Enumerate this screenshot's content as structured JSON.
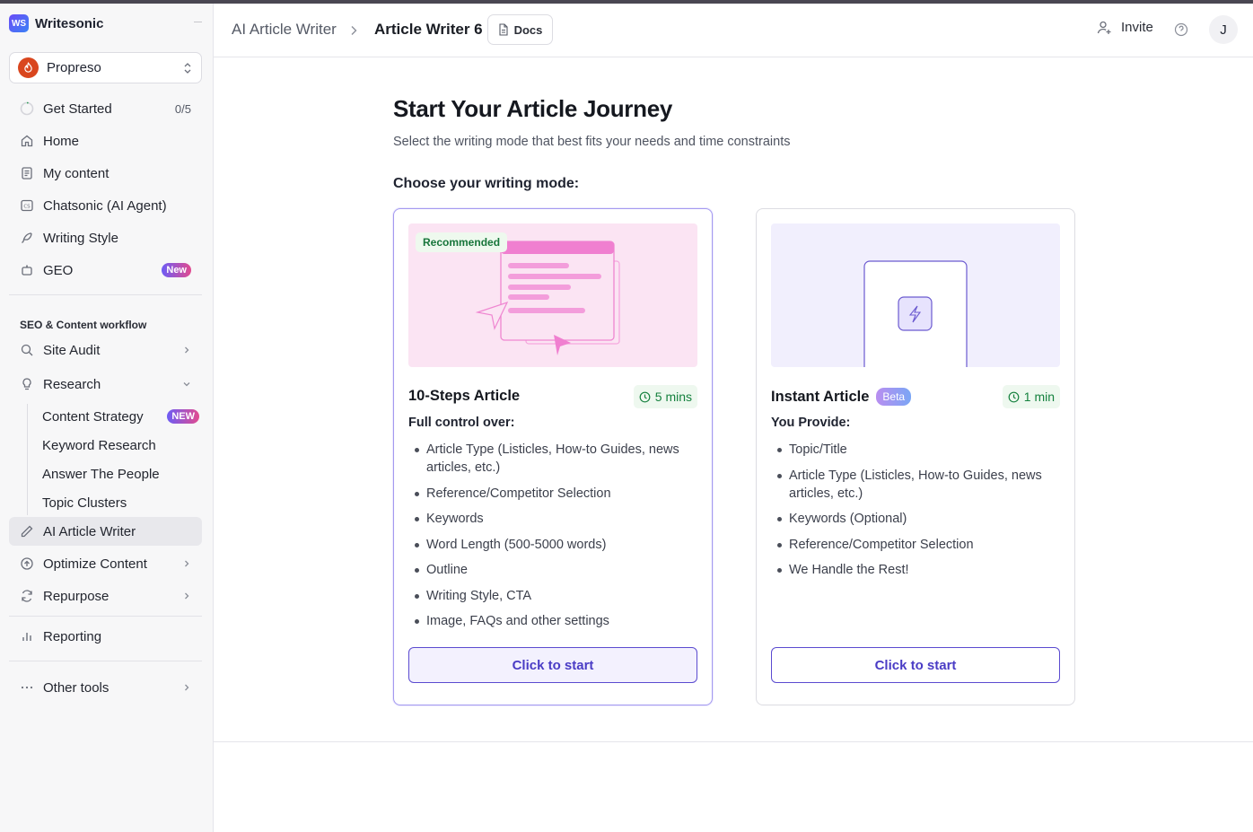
{
  "brand": {
    "logo_text": "WS",
    "name": "Writesonic"
  },
  "workspace": {
    "name": "Propreso"
  },
  "sidebar": {
    "top_items": [
      {
        "label": "Get Started",
        "right": "0/5"
      },
      {
        "label": "Home"
      },
      {
        "label": "My content"
      },
      {
        "label": "Chatsonic (AI Agent)"
      },
      {
        "label": "Writing Style"
      },
      {
        "label": "GEO",
        "badge": "New"
      }
    ],
    "section_label": "SEO & Content workflow",
    "workflow": {
      "site_audit": "Site Audit",
      "research": "Research",
      "research_sub": [
        {
          "label": "Content Strategy",
          "badge": "NEW"
        },
        {
          "label": "Keyword Research"
        },
        {
          "label": "Answer The People"
        },
        {
          "label": "Topic Clusters"
        }
      ],
      "ai_article_writer": "AI Article Writer",
      "optimize_content": "Optimize Content",
      "repurpose": "Repurpose"
    },
    "reporting": "Reporting",
    "other_tools": "Other tools"
  },
  "header": {
    "breadcrumb_parent": "AI Article Writer",
    "breadcrumb_current": "Article Writer 6",
    "docs_label": "Docs",
    "invite_label": "Invite",
    "avatar_initial": "J"
  },
  "main": {
    "title": "Start Your Article Journey",
    "subtitle": "Select the writing mode that best fits your needs and time constraints",
    "choose_label": "Choose your writing mode:",
    "cards": [
      {
        "badge": "Recommended",
        "title": "10-Steps Article",
        "time": "5 mins",
        "provide_label": "Full control over:",
        "items": [
          "Article Type (Listicles, How-to Guides, news articles, etc.)",
          "Reference/Competitor Selection",
          "Keywords",
          "Word Length (500-5000 words)",
          "Outline",
          "Writing Style, CTA",
          "Image, FAQs and other settings"
        ],
        "button": "Click to start"
      },
      {
        "title": "Instant Article",
        "title_badge": "Beta",
        "time": "1 min",
        "provide_label": "You Provide:",
        "items": [
          "Topic/Title",
          "Article Type (Listicles, How-to Guides, news articles, etc.)",
          "Keywords (Optional)",
          "Reference/Competitor Selection",
          "We Handle the Rest!"
        ],
        "button": "Click to start"
      }
    ]
  },
  "colors": {
    "accent": "#5b4bd0",
    "recommended_bg": "#fbe4f3",
    "instant_bg": "#f1effd",
    "time_green": "#15813e"
  }
}
